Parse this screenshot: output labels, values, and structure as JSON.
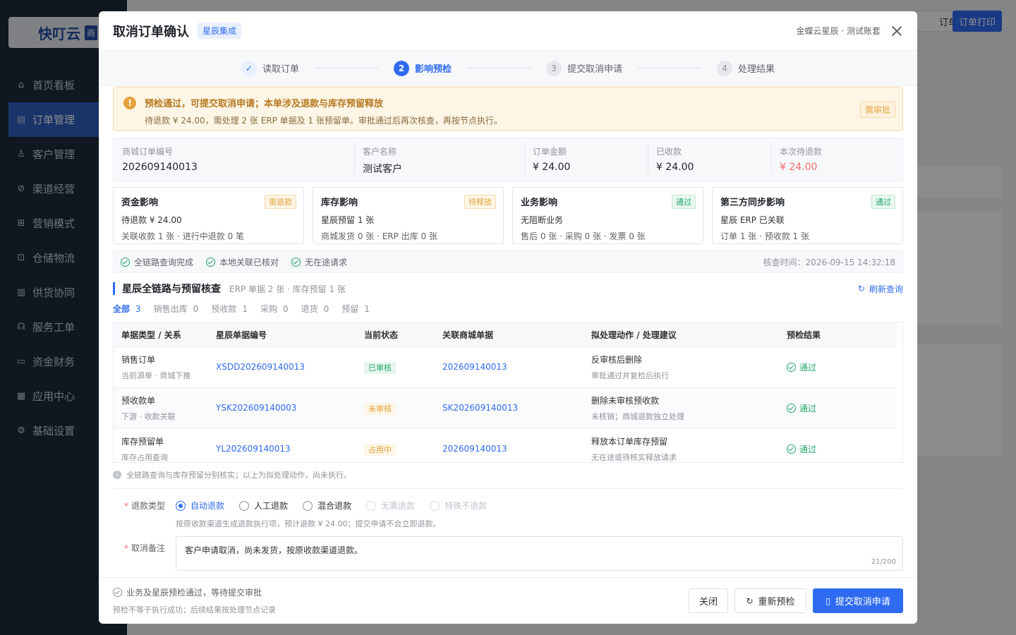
{
  "app": {
    "logo_text": "快叮云",
    "logo_tag": "商",
    "nav": [
      {
        "label": "首页看板",
        "icon": "home-icon"
      },
      {
        "label": "订单管理",
        "icon": "order-icon"
      },
      {
        "label": "客户管理",
        "icon": "user-icon"
      },
      {
        "label": "渠道经营",
        "icon": "channel-icon"
      },
      {
        "label": "营销模式",
        "icon": "gift-icon"
      },
      {
        "label": "仓储物流",
        "icon": "warehouse-icon"
      },
      {
        "label": "供货协同",
        "icon": "supply-icon"
      },
      {
        "label": "服务工单",
        "icon": "headset-icon"
      },
      {
        "label": "资金财务",
        "icon": "wallet-icon"
      },
      {
        "label": "应用中心",
        "icon": "apps-icon"
      },
      {
        "label": "基础设置",
        "icon": "gear-icon"
      }
    ],
    "top_buttons": {
      "order": "订单",
      "print": "订单打印"
    }
  },
  "modal": {
    "title": "取消订单确认",
    "badge": "星辰集成",
    "account": "金蝶云星辰 · 测试账套",
    "steps": [
      {
        "num": "✓",
        "label": "读取订单",
        "state": "done"
      },
      {
        "num": "2",
        "label": "影响预检",
        "state": "active"
      },
      {
        "num": "3",
        "label": "提交取消申请",
        "state": "todo"
      },
      {
        "num": "4",
        "label": "处理结果",
        "state": "todo"
      }
    ],
    "alert": {
      "title": "预检通过，可提交取消申请；本单涉及退款与库存预留释放",
      "desc": "待退款 ¥ 24.00，需处理 2 张 ERP 单据及 1 张预留单。审批通过后再次核查，再按节点执行。",
      "tag": "需审批"
    },
    "summary": [
      {
        "label": "商城订单编号",
        "value": "202609140013"
      },
      {
        "label": "客户名称",
        "value": "测试客户"
      },
      {
        "label": "订单金额",
        "value": "¥ 24.00"
      },
      {
        "label": "已收款",
        "value": "¥ 24.00"
      },
      {
        "label": "本次待退款",
        "value": "¥ 24.00"
      }
    ],
    "cards": [
      {
        "title": "资金影响",
        "tag": "需退款",
        "line1": "待退款 ¥ 24.00",
        "line2": "关联收款 1 张 · 进行中退款 0 笔"
      },
      {
        "title": "库存影响",
        "tag": "待释放",
        "line1": "星辰预留 1 张",
        "line2": "商城发货 0 张 · ERP 出库 0 张"
      },
      {
        "title": "业务影响",
        "tag": "通过",
        "line1": "无阻断业务",
        "line2": "售后 0 张 · 采购 0 张 · 发票 0 张"
      },
      {
        "title": "第三方同步影响",
        "tag": "通过",
        "line1": "星辰 ERP 已关联",
        "line2": "订单 1 张 · 预收款 1 张"
      }
    ],
    "checks": [
      "全链路查询完成",
      "本地关联已核对",
      "无在途请求"
    ],
    "check_time": "核查时间：2026-09-15 14:32:18",
    "section": {
      "title": "星辰全链路与预留核查",
      "sub": "ERP 单据 2 张 · 库存预留 1 张",
      "refresh": "刷新查询"
    },
    "filters": [
      {
        "label": "全部",
        "count": "3"
      },
      {
        "label": "销售出库",
        "count": "0"
      },
      {
        "label": "预收款",
        "count": "1"
      },
      {
        "label": "采购",
        "count": "0"
      },
      {
        "label": "退货",
        "count": "0"
      },
      {
        "label": "预留",
        "count": "1"
      }
    ],
    "table": {
      "headers": [
        "单据类型 / 关系",
        "星辰单据编号",
        "当前状态",
        "关联商城单据",
        "拟处理动作 / 处理建议",
        "预检结果"
      ],
      "rows": [
        {
          "type": "销售订单",
          "rel": "当前源单 · 商城下推",
          "no": "XSDD202609140013",
          "status": "已审核",
          "link": "202609140013",
          "action": "反审核后删除",
          "advice": "审批通过并复检后执行",
          "result": "通过"
        },
        {
          "type": "预收款单",
          "rel": "下游 · 收款关联",
          "no": "YSK202609140003",
          "status": "未审核",
          "link": "SK202609140013",
          "action": "删除未审核预收款",
          "advice": "未核销；商城退款独立处理",
          "result": "通过"
        },
        {
          "type": "库存预留单",
          "rel": "库存占用查询",
          "no": "YL202609140013",
          "status": "占用中",
          "link": "202609140013",
          "action": "释放本订单库存预留",
          "advice": "无在途或待核实释放请求",
          "result": "通过"
        }
      ]
    },
    "note": "全链路查询与库存预留分别核实；以上为拟处理动作，尚未执行。",
    "refund": {
      "label": "退款类型",
      "options": [
        "自动退款",
        "人工退款",
        "混合退款",
        "无需退款",
        "特殊不退款"
      ],
      "hint": "按原收款渠道生成退款执行项，预计退款 ¥ 24.00；提交申请不会立即退款。"
    },
    "remark": {
      "label": "取消备注",
      "value": "客户申请取消，尚未发货，按原收款渠道退款。",
      "count": "21/200"
    },
    "footer": {
      "status": "业务及星辰预检通过，等待提交审批",
      "sub": "预检不等于执行成功；后续结果按处理节点记录",
      "close": "关闭",
      "recheck": "重新预检",
      "submit": "提交取消申请"
    }
  }
}
